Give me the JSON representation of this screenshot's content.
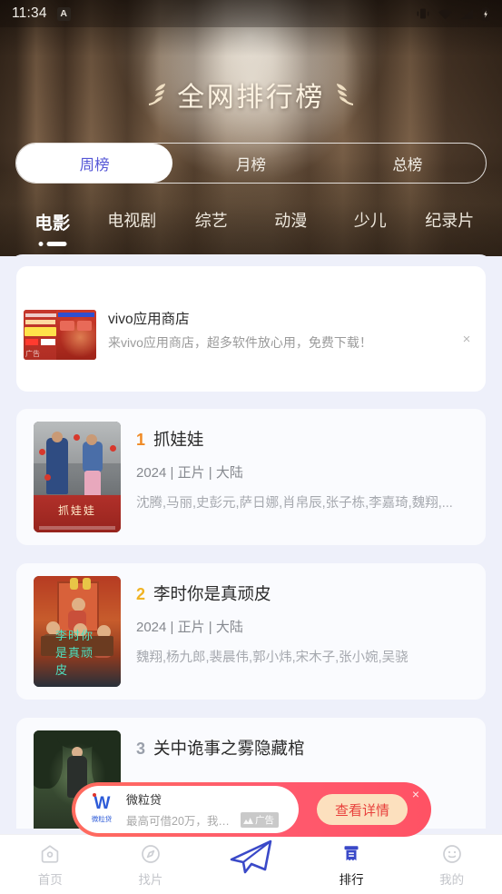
{
  "status_bar": {
    "time": "11:34",
    "badge": "A",
    "icons": [
      "vibrate-icon",
      "wifi-icon",
      "signal-icon",
      "battery-charging-icon"
    ]
  },
  "header": {
    "title": "全网排行榜",
    "ornament": "laurel-icon"
  },
  "segmented": {
    "options": [
      {
        "label": "周榜",
        "active": true
      },
      {
        "label": "月榜",
        "active": false
      },
      {
        "label": "总榜",
        "active": false
      }
    ]
  },
  "categories": [
    {
      "label": "电影",
      "active": true
    },
    {
      "label": "电视剧",
      "active": false
    },
    {
      "label": "综艺",
      "active": false
    },
    {
      "label": "动漫",
      "active": false
    },
    {
      "label": "少儿",
      "active": false
    },
    {
      "label": "纪录片",
      "active": false
    }
  ],
  "ad_card": {
    "title": "vivo应用商店",
    "desc": "来vivo应用商店，超多软件放心用，免费下载！",
    "thumb_tag": "广告",
    "close": "×"
  },
  "ranking": [
    {
      "rank": "1",
      "title": "抓娃娃",
      "meta": "2024 | 正片 | 大陆",
      "cast": "沈腾,马丽,史彭元,萨日娜,肖帛辰,张子栋,李嘉琦,魏翔,...",
      "poster_title": "抓娃娃"
    },
    {
      "rank": "2",
      "title": "李时你是真顽皮",
      "meta": "2024 | 正片 | 大陆",
      "cast": "魏翔,杨九郎,裴晨伟,郭小炜,宋木子,张小婉,吴骁",
      "poster_title": "李时你是真顽皮"
    },
    {
      "rank": "3",
      "title": "关中诡事之雾隐藏棺",
      "meta": "",
      "cast": "",
      "poster_title": ""
    }
  ],
  "float_ad": {
    "brand": "微粒贷",
    "logo_mark": "W",
    "logo_sub": "微粒贷",
    "desc": "最高可借20万，我借了...",
    "ad_chip": "广告",
    "cta": "查看详情",
    "close": "×"
  },
  "bottom_nav": [
    {
      "label": "首页",
      "icon": "home-icon",
      "active": false
    },
    {
      "label": "找片",
      "icon": "compass-icon",
      "active": false
    },
    {
      "label": "",
      "icon": "paper-plane-icon",
      "active": false
    },
    {
      "label": "排行",
      "icon": "ranking-icon",
      "active": true
    },
    {
      "label": "我的",
      "icon": "smiley-icon",
      "active": false
    }
  ],
  "colors": {
    "accent_blue": "#5456D6",
    "rank1": "#F08A24",
    "rank2": "#F0B324",
    "rank3": "#9AA0AB",
    "page_bg": "#EEF0FA",
    "ad_red": "#FF5A6E",
    "cta_bg": "#FCE0BE",
    "cta_text": "#E8403C"
  }
}
